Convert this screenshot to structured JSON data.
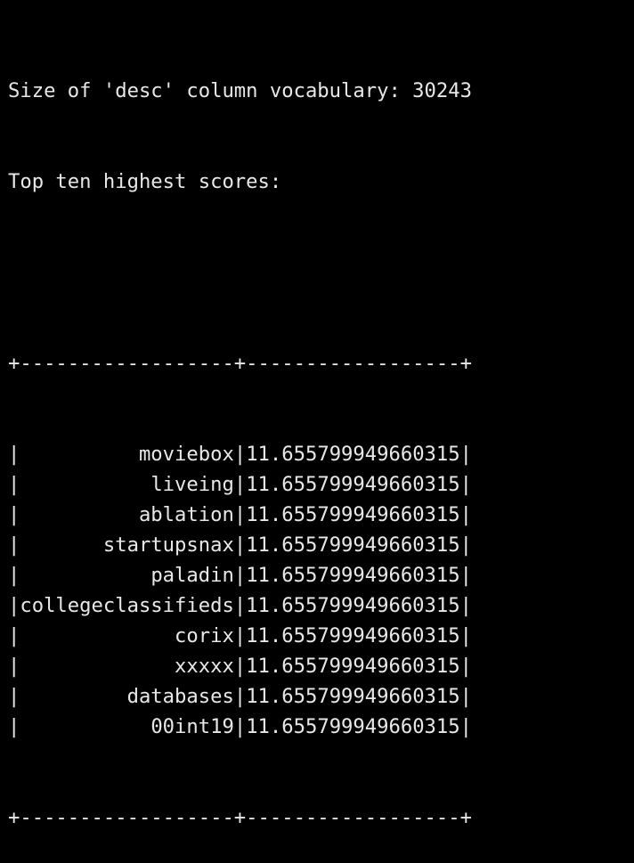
{
  "terminal": {
    "header_lines": [
      "Size of 'desc' column vocabulary: 30243",
      "Top ten highest scores:"
    ],
    "table_border": "+------------------+------------------+",
    "rows": [
      {
        "word": "moviebox",
        "score": "11.655799949660315"
      },
      {
        "word": "liveing",
        "score": "11.655799949660315"
      },
      {
        "word": "ablation",
        "score": "11.655799949660315"
      },
      {
        "word": "startupsnax",
        "score": "11.655799949660315"
      },
      {
        "word": "paladin",
        "score": "11.655799949660315"
      },
      {
        "word": "collegeclassifieds",
        "score": "11.655799949660315"
      },
      {
        "word": "corix",
        "score": "11.655799949660315"
      },
      {
        "word": "xxxxx",
        "score": "11.655799949660315"
      },
      {
        "word": "databases",
        "score": "11.655799949660315"
      },
      {
        "word": "00int19",
        "score": "11.655799949660315"
      }
    ]
  },
  "colors": {
    "background": "#000000",
    "text": "#e8e8e8"
  }
}
